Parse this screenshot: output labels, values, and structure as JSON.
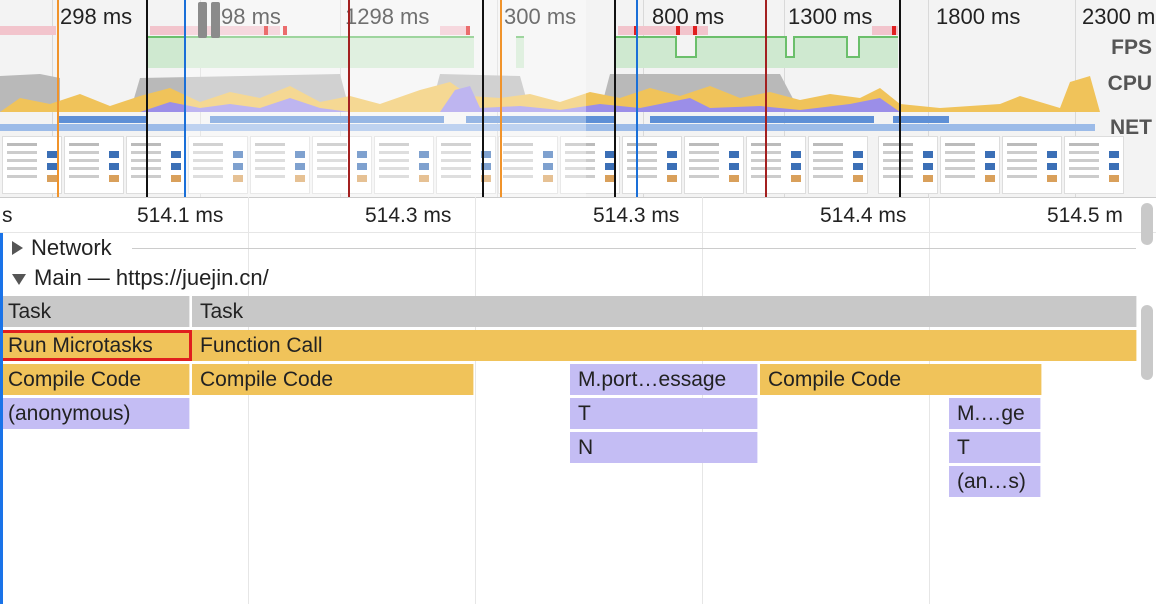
{
  "overview": {
    "ticks": [
      "298 ms",
      "98 ms",
      "1298 ms",
      "300 ms",
      "800 ms",
      "1300 ms",
      "1800 ms",
      "2300 m"
    ],
    "lanes": {
      "fps": "FPS",
      "cpu": "CPU",
      "net": "NET"
    }
  },
  "ruler": {
    "ticks": [
      "s",
      "514.1 ms",
      "514.3 ms",
      "514.3 ms",
      "514.4 ms",
      "514.5 m"
    ]
  },
  "tracks": {
    "network": {
      "label": "Network",
      "expanded": false
    },
    "main": {
      "label": "Main — https://juejin.cn/",
      "expanded": true
    }
  },
  "flame": {
    "row0": [
      "Task",
      "Task"
    ],
    "row1": [
      "Run Microtasks",
      "Function Call"
    ],
    "row2": [
      "Compile Code",
      "Compile Code",
      "M.port…essage",
      "Compile Code"
    ],
    "row3": [
      "(anonymous)",
      "T",
      "M.…ge"
    ],
    "row4": [
      "N",
      "T"
    ],
    "row5": [
      "(an…s)"
    ]
  },
  "colors": {
    "task": "#c8c8c8",
    "scripting": "#f0c35a",
    "js_frame": "#c4bdf4",
    "selection_outline": "#e01e1e"
  }
}
